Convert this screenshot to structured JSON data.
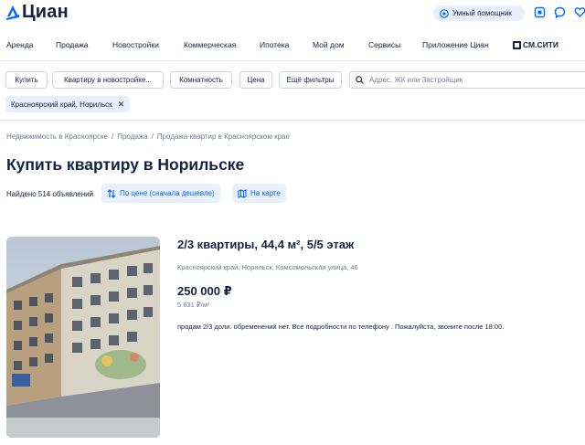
{
  "header": {
    "logo_text": "Циан",
    "assistant_label": "Умный помощник",
    "icons": [
      "compare-icon",
      "chat-icon",
      "favorites-heart-icon"
    ]
  },
  "nav": {
    "items": [
      "Аренда",
      "Продажа",
      "Новостройки",
      "Коммерческая",
      "Ипотека",
      "Мой дом",
      "Сервисы",
      "Приложение Циан",
      "СМ.СИТИ"
    ]
  },
  "filters": {
    "deal": "Купить",
    "type": "Квартиру в новостройке...",
    "rooms": "Комнатность",
    "price": "Цена",
    "more": "Ещё фильтры",
    "search_placeholder": "Адрес, ЖК или Застройщик"
  },
  "chip": {
    "label": "Красноярский край, Норильск"
  },
  "breadcrumbs": [
    "Недвижимость в Красноярске",
    "Продажа",
    "Продажа квартир в Красноярском крае"
  ],
  "page": {
    "title": "Купить квартиру в Норильске",
    "found": "Найдено 514 объявлений",
    "sort_label": "По цене (сначала дешевле)",
    "map_label": "На карте"
  },
  "listing": {
    "title": "2/3 квартиры, 44,4 м², 5/5 этаж",
    "address": "Красноярский край, Норильск, Комсомольская улица, 46",
    "price": "250 000 ₽",
    "price_per_sqm": "5 631 ₽/м²",
    "description": "продам 2/3 доли. обременений нет. Все подробности по телефону . Пожалуйста, звоните после 18:00."
  },
  "colors": {
    "accent": "#0468ff",
    "text": "#152242",
    "muted": "#707a8c",
    "chip_bg": "#e9f0fc"
  }
}
